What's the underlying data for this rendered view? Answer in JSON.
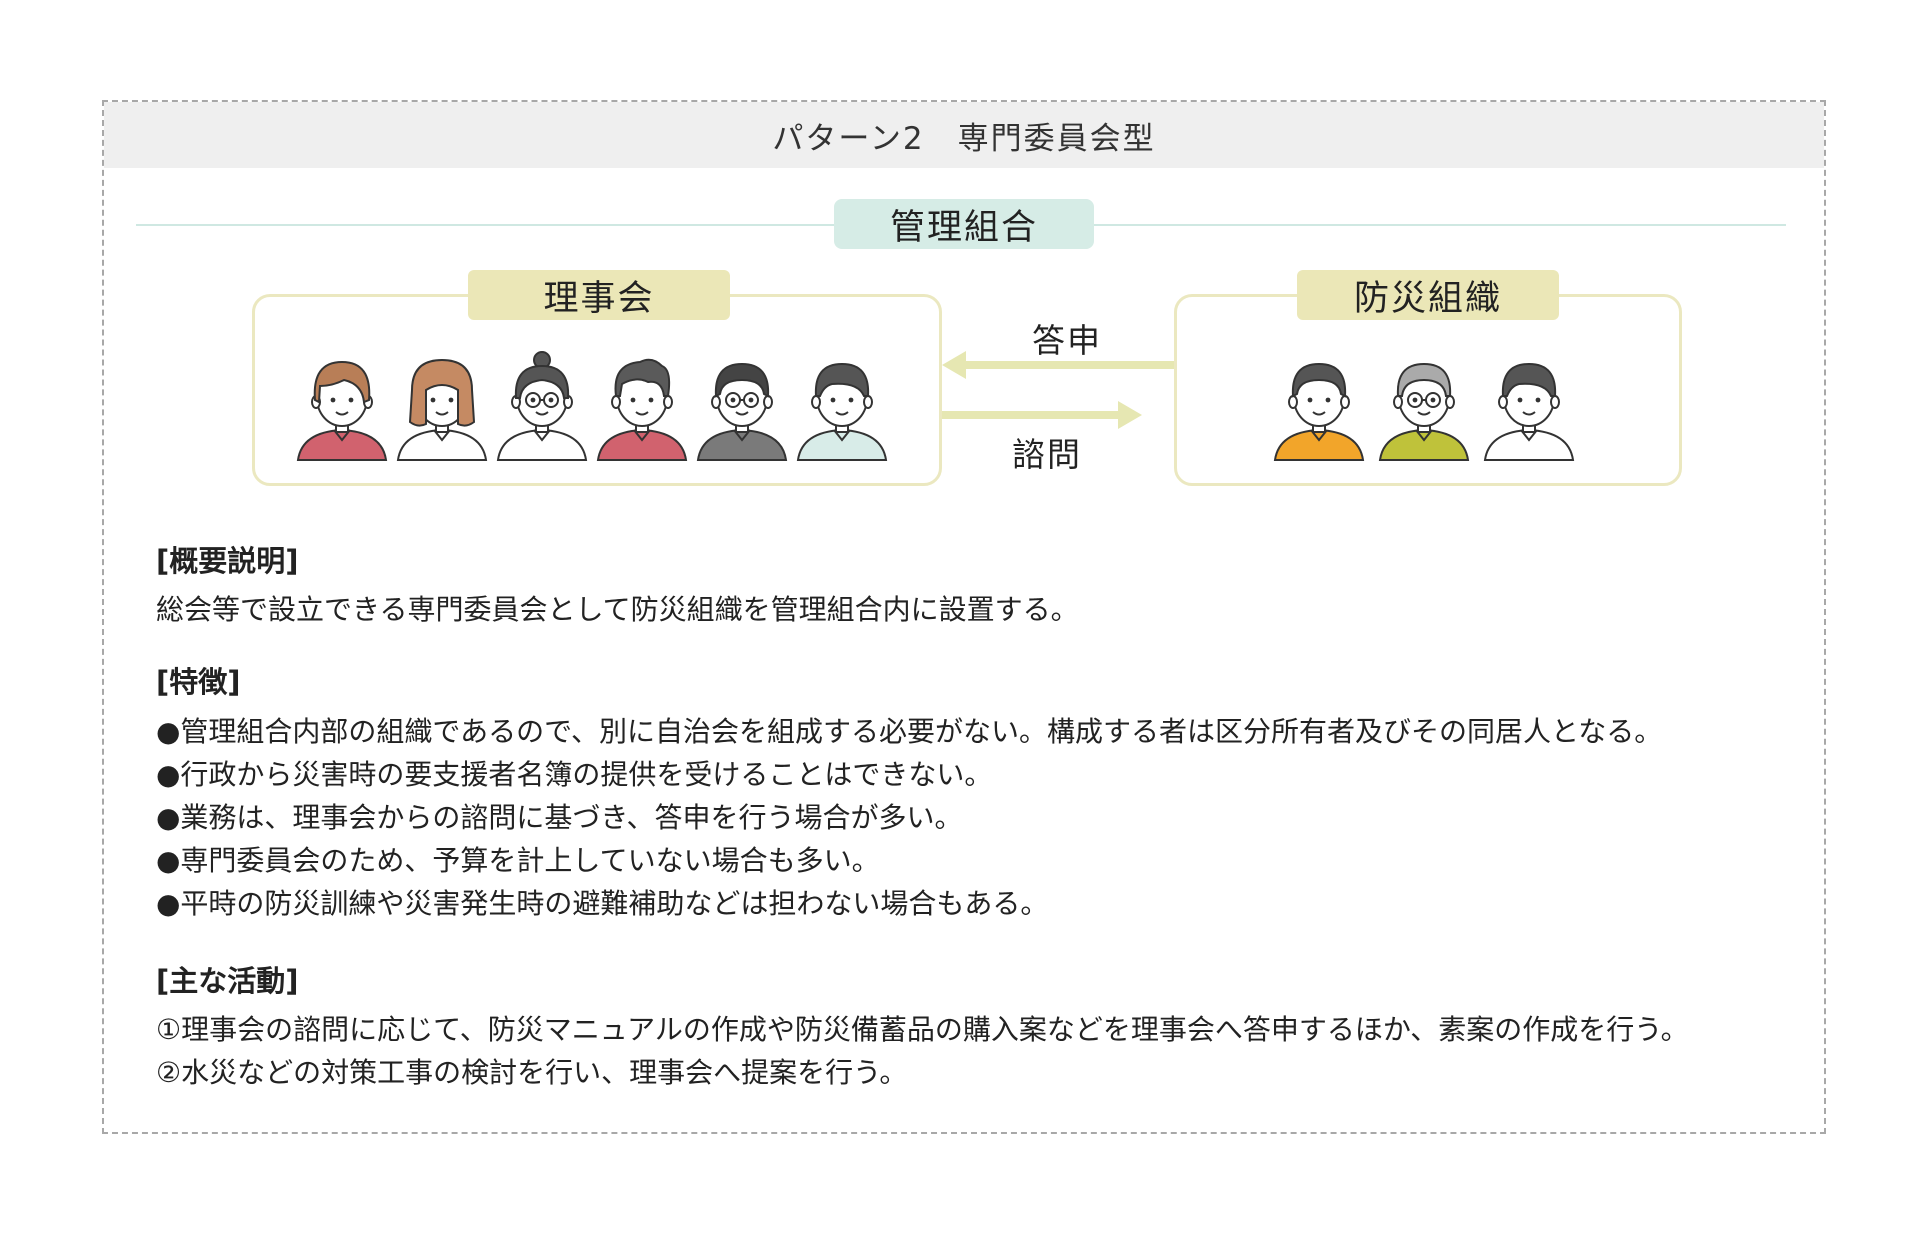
{
  "title": "パターン2　専門委員会型",
  "diagram": {
    "management": "管理組合",
    "board": {
      "label": "理事会",
      "members": [
        {
          "hair": "#b87e57",
          "shirt": "#d1626e",
          "glasses": false,
          "style": "f-short"
        },
        {
          "hair": "#c58a63",
          "shirt": "#ffffff",
          "glasses": false,
          "style": "f-long"
        },
        {
          "hair": "#555555",
          "shirt": "#ffffff",
          "glasses": true,
          "style": "f-bun"
        },
        {
          "hair": "#5a5a5a",
          "shirt": "#d1626e",
          "glasses": false,
          "style": "m-wave"
        },
        {
          "hair": "#444444",
          "shirt": "#7a7a7a",
          "glasses": true,
          "style": "m-short"
        },
        {
          "hair": "#555555",
          "shirt": "#d8ece8",
          "glasses": false,
          "style": "m-side"
        }
      ]
    },
    "disaster": {
      "label": "防災組織",
      "members": [
        {
          "hair": "#555555",
          "shirt": "#f2a52a",
          "glasses": false,
          "style": "m-short"
        },
        {
          "hair": "#aaaaaa",
          "shirt": "#bfc23a",
          "glasses": true,
          "style": "m-gray"
        },
        {
          "hair": "#555555",
          "shirt": "#ffffff",
          "glasses": false,
          "style": "m-side"
        }
      ]
    },
    "arrow_left_label": "答申",
    "arrow_right_label": "諮問",
    "colors": {
      "arrow": "#e6e7b2",
      "group_border": "#ebe8c0",
      "label_bg": "#ebe7b7",
      "mgmt_bg": "#d6ece6"
    }
  },
  "summary": {
    "title": "[概要説明]",
    "text": "総会等で設立できる専門委員会として防災組織を管理組合内に設置する。"
  },
  "features": {
    "title": "[特徴]",
    "items": [
      "●管理組合内部の組織であるので、別に自治会を組成する必要がない。構成する者は区分所有者及びその同居人となる。",
      "●行政から災害時の要支援者名簿の提供を受けることはできない。",
      "●業務は、理事会からの諮問に基づき、答申を行う場合が多い。",
      "●専門委員会のため、予算を計上していない場合も多い。",
      "●平時の防災訓練や災害発生時の避難補助などは担わない場合もある。"
    ]
  },
  "activities": {
    "title": "[主な活動]",
    "items": [
      "①理事会の諮問に応じて、防災マニュアルの作成や防災備蓄品の購入案などを理事会へ答申するほか、素案の作成を行う。",
      "②水災などの対策工事の検討を行い、理事会へ提案を行う。"
    ]
  }
}
